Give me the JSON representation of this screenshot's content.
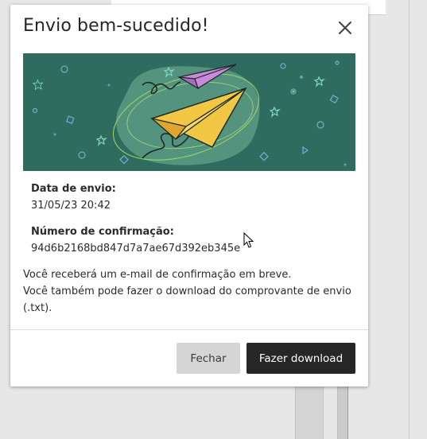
{
  "modal": {
    "title": "Envio bem-sucedido!",
    "submission_date_label": "Data de envio:",
    "submission_date_value": "31/05/23 20:42",
    "confirmation_label": "Número de confirmação:",
    "confirmation_value": "94d6b2168bd847d7a7ae67d392eb345e",
    "message_line1": "Você receberá um e-mail de confirmação em breve.",
    "message_line2": "Você também pode fazer o download do comprovante de envio (.txt).",
    "close_button_label": "Fechar",
    "download_button_label": "Fazer download",
    "close_icon": "close-icon"
  },
  "banner": {
    "icons": [
      "paper-plane-icon",
      "paper-plane-icon"
    ],
    "colors": {
      "background": "#2f6b5e",
      "blob": "#5a9a82",
      "plane_large": "#f2c744",
      "plane_small": "#c98bd8",
      "accent": "#7fd8c4"
    }
  },
  "colors": {
    "primary_button": "#262626",
    "secondary_button": "#d5d5d5",
    "text": "#2b2b2b"
  }
}
